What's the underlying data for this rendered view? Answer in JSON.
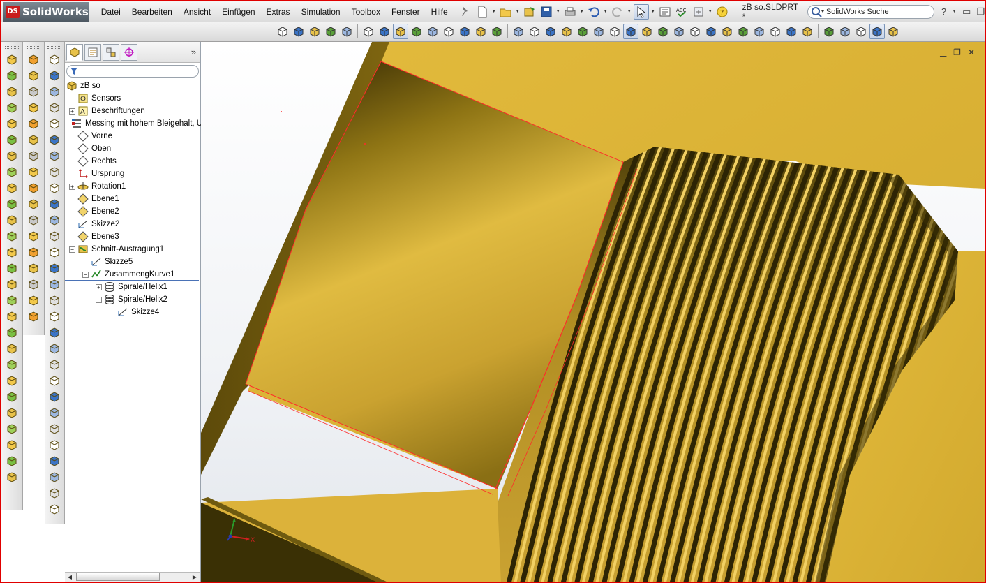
{
  "app": {
    "name": "SolidWorks",
    "ds_mark": "DS",
    "document_title": "zB so.SLDPRT *"
  },
  "menu": [
    "Datei",
    "Bearbeiten",
    "Ansicht",
    "Einfügen",
    "Extras",
    "Simulation",
    "Toolbox",
    "Fenster",
    "Hilfe"
  ],
  "search": {
    "value": "SolidWorks Suche"
  },
  "help": {
    "question": "?"
  },
  "tree": {
    "root": "zB so",
    "nodes": [
      {
        "label": "Sensors",
        "icon": "sensors-icon",
        "indent": 1,
        "expander": ""
      },
      {
        "label": "Beschriftungen",
        "icon": "annotations-icon",
        "indent": 1,
        "expander": "+"
      },
      {
        "label": "Messing mit hohem Bleigehalt, U",
        "icon": "material-icon",
        "indent": 1,
        "expander": ""
      },
      {
        "label": "Vorne",
        "icon": "plane-icon",
        "indent": 1,
        "expander": ""
      },
      {
        "label": "Oben",
        "icon": "plane-icon",
        "indent": 1,
        "expander": ""
      },
      {
        "label": "Rechts",
        "icon": "plane-icon",
        "indent": 1,
        "expander": ""
      },
      {
        "label": "Ursprung",
        "icon": "origin-icon",
        "indent": 1,
        "expander": ""
      },
      {
        "label": "Rotation1",
        "icon": "revolve-icon",
        "indent": 1,
        "expander": "+"
      },
      {
        "label": "Ebene1",
        "icon": "ref-plane-icon",
        "indent": 1,
        "expander": ""
      },
      {
        "label": "Ebene2",
        "icon": "ref-plane-icon",
        "indent": 1,
        "expander": ""
      },
      {
        "label": "Skizze2",
        "icon": "sketch-icon",
        "indent": 1,
        "expander": ""
      },
      {
        "label": "Ebene3",
        "icon": "ref-plane-icon",
        "indent": 1,
        "expander": ""
      },
      {
        "label": "Schnitt-Austragung1",
        "icon": "swept-cut-icon",
        "indent": 1,
        "expander": "−"
      },
      {
        "label": "Skizze5",
        "icon": "sketch-icon",
        "indent": 2,
        "expander": ""
      },
      {
        "label": "ZusammengKurve1",
        "icon": "composite-curve-icon",
        "indent": 2,
        "expander": "−"
      },
      {
        "label": "Spirale/Helix1",
        "icon": "helix-icon",
        "indent": 3,
        "expander": "+"
      },
      {
        "label": "Spirale/Helix2",
        "icon": "helix-icon",
        "indent": 3,
        "expander": "−"
      },
      {
        "label": "Skizze4",
        "icon": "sketch-icon",
        "indent": 4,
        "expander": ""
      }
    ]
  },
  "colors": {
    "brass_light": "#e8c24a",
    "brass_mid": "#d4ad33",
    "brass_dark": "#6e5a10",
    "edge_highlight": "#ff0000",
    "frame_border": "#e00000",
    "tree_rollback": "#4a72b6"
  },
  "triad": {
    "x_label": "X"
  }
}
